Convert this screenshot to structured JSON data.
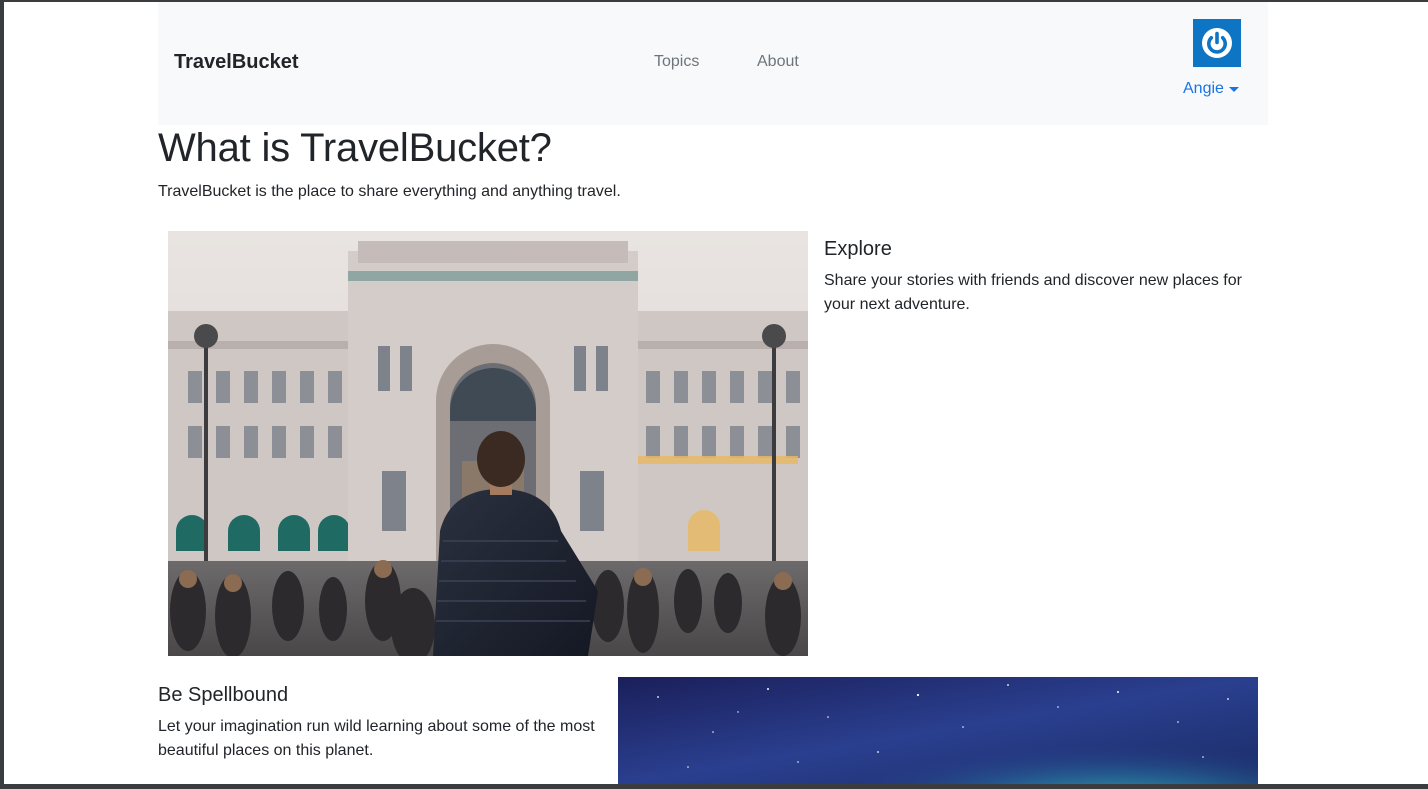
{
  "navbar": {
    "brand": "TravelBucket",
    "links": [
      {
        "label": "Topics"
      },
      {
        "label": "About"
      }
    ],
    "user": {
      "name": "Angie",
      "avatar_icon": "power-icon",
      "avatar_color": "#0e75c4"
    }
  },
  "main": {
    "title": "What is TravelBucket?",
    "lead": "TravelBucket is the place to share everything and anything travel.",
    "features": [
      {
        "heading": "Explore",
        "text": "Share your stories with friends and discover new places for your next adventure.",
        "image": "city-plaza-photo"
      },
      {
        "heading": "Be Spellbound",
        "text": "Let your imagination run wild learning about some of the most beautiful places on this planet.",
        "image": "aurora-night-sky-photo"
      }
    ]
  },
  "colors": {
    "link": "#1a73e8",
    "navbar_bg": "#f8f9fa",
    "muted_link": "#6c757d"
  }
}
